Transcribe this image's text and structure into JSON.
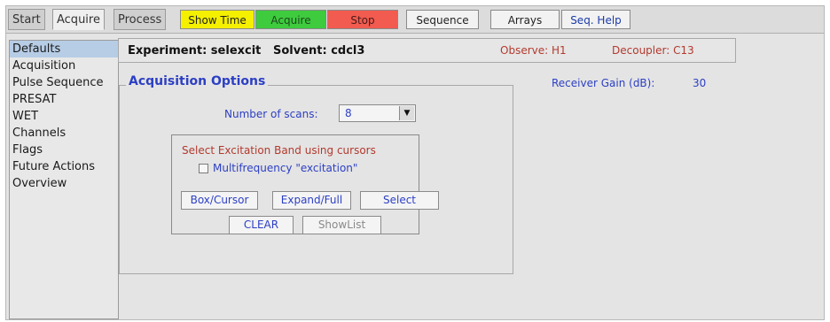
{
  "tabs": [
    {
      "label": "Start"
    },
    {
      "label": "Acquire"
    },
    {
      "label": "Process"
    }
  ],
  "toolbar": {
    "show_time": "Show Time",
    "acquire": "Acquire",
    "stop": "Stop",
    "sequence": "Sequence",
    "arrays": "Arrays",
    "seq_help": "Seq. Help"
  },
  "sidebar": {
    "items": [
      {
        "label": "Defaults"
      },
      {
        "label": "Acquisition"
      },
      {
        "label": "Pulse Sequence"
      },
      {
        "label": "PRESAT"
      },
      {
        "label": "WET"
      },
      {
        "label": "Channels"
      },
      {
        "label": "Flags"
      },
      {
        "label": "Future Actions"
      },
      {
        "label": "Overview"
      }
    ]
  },
  "header": {
    "experiment": "Experiment: selexcit   Solvent: cdcl3",
    "observe": "Observe: H1",
    "decoupler": "Decoupler: C13"
  },
  "acq": {
    "title": "Acquisition Options",
    "receiver_gain_label": "Receiver Gain (dB):",
    "receiver_gain_value": "30",
    "scans_label": "Number of scans:",
    "scans_value": "8",
    "cursor_title": "Select Excitation Band using cursors",
    "multifreq_label": "Multifrequency \"excitation\"",
    "box_cursor": "Box/Cursor",
    "expand_full": "Expand/Full",
    "select": "Select",
    "clear": "CLEAR",
    "showlist": "ShowList"
  },
  "colors": {
    "show_time": "#f4f000",
    "acquire": "#3ecb3e",
    "stop": "#f25b4f",
    "label_blue": "#2c3fc4",
    "label_red": "#b23a2e",
    "selected": "#b7cde6"
  }
}
